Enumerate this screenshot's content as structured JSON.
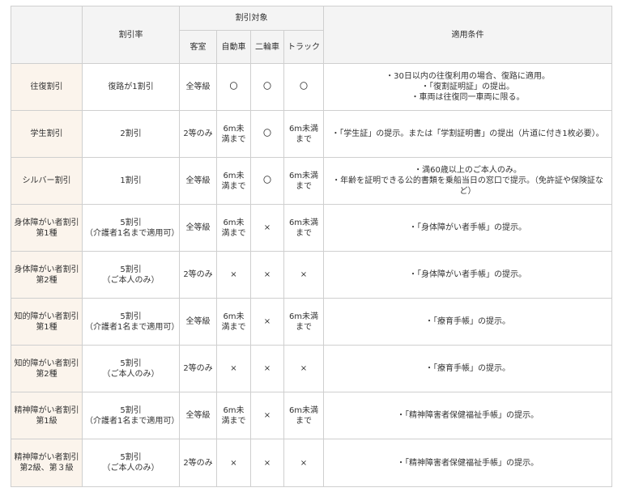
{
  "header": {
    "discount_rate": "割引率",
    "discount_target": "割引対象",
    "guest_room": "客室",
    "car": "自動車",
    "motorcycle": "二輪車",
    "truck": "トラック",
    "conditions": "適用条件"
  },
  "rows": [
    {
      "name": "往復割引",
      "rate": "復路が1割引",
      "room": "全等級",
      "car": "〇",
      "bike": "〇",
      "truck": "〇",
      "cond": "・30日以内の往復利用の場合、復路に適用。\n・「復割証明証」の提出。\n・車両は往復同一車両に限る。"
    },
    {
      "name": "学生割引",
      "rate": "2割引",
      "room": "2等のみ",
      "car": "6m未満まで",
      "bike": "〇",
      "truck": "6m未満まで",
      "cond": "・「学生証」の提示。または「学割証明書」の提出（片道に付き1枚必要）。"
    },
    {
      "name": "シルバー割引",
      "rate": "1割引",
      "room": "全等級",
      "car": "6m未満まで",
      "bike": "〇",
      "truck": "6m未満まで",
      "cond": "・満60歳以上のご本人のみ。\n・年齢を証明できる公的書類を乗船当日の窓口で提示。（免許証や保険証など）"
    },
    {
      "name": "身体障がい者割引\n第1種",
      "rate": "5割引\n（介護者1名まで適用可）",
      "room": "全等級",
      "car": "6m未満まで",
      "bike": "×",
      "truck": "6m未満まで",
      "cond": "・「身体障がい者手帳」の提示。"
    },
    {
      "name": "身体障がい者割引\n第2種",
      "rate": "5割引\n（ご本人のみ）",
      "room": "2等のみ",
      "car": "×",
      "bike": "×",
      "truck": "×",
      "cond": "・「身体障がい者手帳」の提示。"
    },
    {
      "name": "知的障がい者割引\n第1種",
      "rate": "5割引\n（介護者1名まで適用可）",
      "room": "全等級",
      "car": "6m未満まで",
      "bike": "×",
      "truck": "6m未満まで",
      "cond": "・「療育手帳」の提示。"
    },
    {
      "name": "知的障がい者割引\n第2種",
      "rate": "5割引\n（ご本人のみ）",
      "room": "2等のみ",
      "car": "×",
      "bike": "×",
      "truck": "×",
      "cond": "・「療育手帳」の提示。"
    },
    {
      "name": "精神障がい者割引\n第1級",
      "rate": "5割引\n（介護者1名まで適用可）",
      "room": "全等級",
      "car": "6m未満まで",
      "bike": "×",
      "truck": "6m未満まで",
      "cond": "・「精神障害者保健福祉手帳」の提示。"
    },
    {
      "name": "精神障がい者割引\n第2級、第３級",
      "rate": "5割引\n（ご本人のみ）",
      "room": "2等のみ",
      "car": "×",
      "bike": "×",
      "truck": "×",
      "cond": "・「精神障害者保健福祉手帳」の提示。"
    }
  ]
}
